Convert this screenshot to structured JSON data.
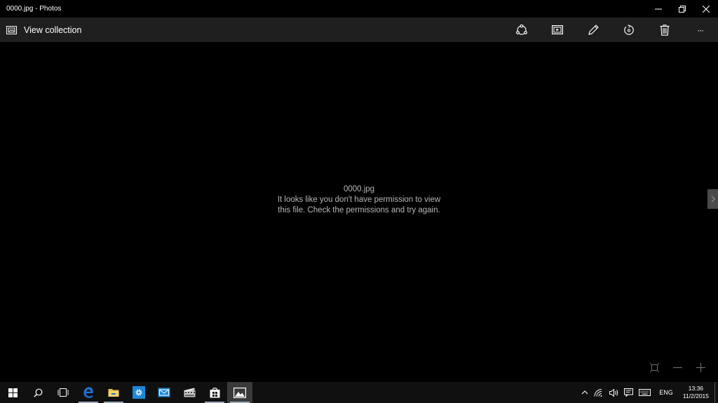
{
  "window": {
    "title": "0000.jpg - Photos"
  },
  "toolbar": {
    "view_collection_label": "View collection",
    "more_label": "···"
  },
  "viewer": {
    "file_name": "0000.jpg",
    "error_line1": "It looks like you don't have permission to view",
    "error_line2": "this file. Check the permissions and try again."
  },
  "taskbar": {
    "language": "ENG",
    "time": "13:36",
    "date": "11/2/2015"
  },
  "colors": {
    "titlebar_bg": "#000000",
    "toolbar_bg": "#1f1f1f",
    "viewer_bg": "#000000",
    "taskbar_bg": "#101010",
    "message_text": "#b8b8b8",
    "edge_blue": "#1e74d6",
    "settings_blue": "#1e88d8"
  }
}
